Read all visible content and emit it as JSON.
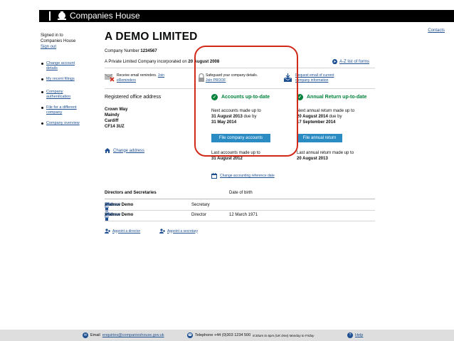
{
  "header": {
    "brand": "Companies House"
  },
  "corner_link": "Contacts",
  "sidebar": {
    "signed_in_line1": "Signed in to",
    "signed_in_line2": "Companies House",
    "sign_out": "Sign out",
    "items": [
      {
        "line1": "Change account",
        "line2": "details"
      },
      {
        "line1": "My recent filings",
        "line2": ""
      },
      {
        "line1": "Company",
        "line2": "authentication"
      },
      {
        "line1": "File for a different",
        "line2": "company"
      },
      {
        "line1": "Company overview",
        "line2": ""
      }
    ]
  },
  "company": {
    "name": "A DEMO LIMITED",
    "number_label": "Company Number",
    "number": "1234567",
    "desc_prefix": "A Private Limited Company incorporated on",
    "incorporated": "20 August 2008",
    "az_link": "A-Z list of forms"
  },
  "promos": {
    "reminders_text": "Receive email reminders.",
    "reminders_link1": "Join",
    "reminders_link2": "eReminders",
    "proof_text": "Safeguard your company details.",
    "proof_link": "Join PROOF",
    "request_line1": "Request email of current",
    "request_line2": "company information"
  },
  "registered_office": {
    "title": "Registered office address",
    "lines": [
      "Crown Way",
      "Maindy",
      "Cardiff",
      "CF14 3UZ"
    ],
    "change_link": "Change address"
  },
  "accounts": {
    "status": "Accounts up-to-date",
    "next_label": "Next accounts made up to",
    "next_date": "31 August 2013",
    "due_by": "due by",
    "due_date": "31 May 2014",
    "button": "File company accounts",
    "last_label": "Last accounts made up to",
    "last_date": "31 August 2012",
    "change_ref": "Change accounting reference date"
  },
  "annual_return": {
    "status": "Annual Return up-to-date",
    "next_label": "Next annual return made up to",
    "next_date": "20 August 2014",
    "due_by": "due by",
    "due_date": "17 September 2014",
    "button": "File annual return",
    "last_label": "Last annual return made up to",
    "last_date": "20 August 2013"
  },
  "directors": {
    "heading": "Directors and Secretaries",
    "dob_heading": "Date of birth",
    "rows": [
      {
        "name": "Andrew Demo",
        "role": "Secretary",
        "dob": "",
        "edit": "Edit",
        "remove": "Remove"
      },
      {
        "name": "Andrew Demo",
        "role": "Director",
        "dob": "12 March 1971",
        "edit": "Edit",
        "remove": "Remove"
      }
    ],
    "appoint_director": "Appoint a director",
    "appoint_secretary": "Appoint a secretary"
  },
  "footer": {
    "email_label": "Email",
    "email": "enquiries@companieshouse.gov.uk",
    "phone_label": "Telephone +44 (0)303 1234 500",
    "hours": "8:30am to 6pm (UK time) Monday to Friday",
    "help": "Help"
  },
  "colors": {
    "status_green": "#00823b",
    "button_blue": "#2b8cc4",
    "link_blue": "#1d4f91",
    "highlight_red": "#d12a1a"
  }
}
